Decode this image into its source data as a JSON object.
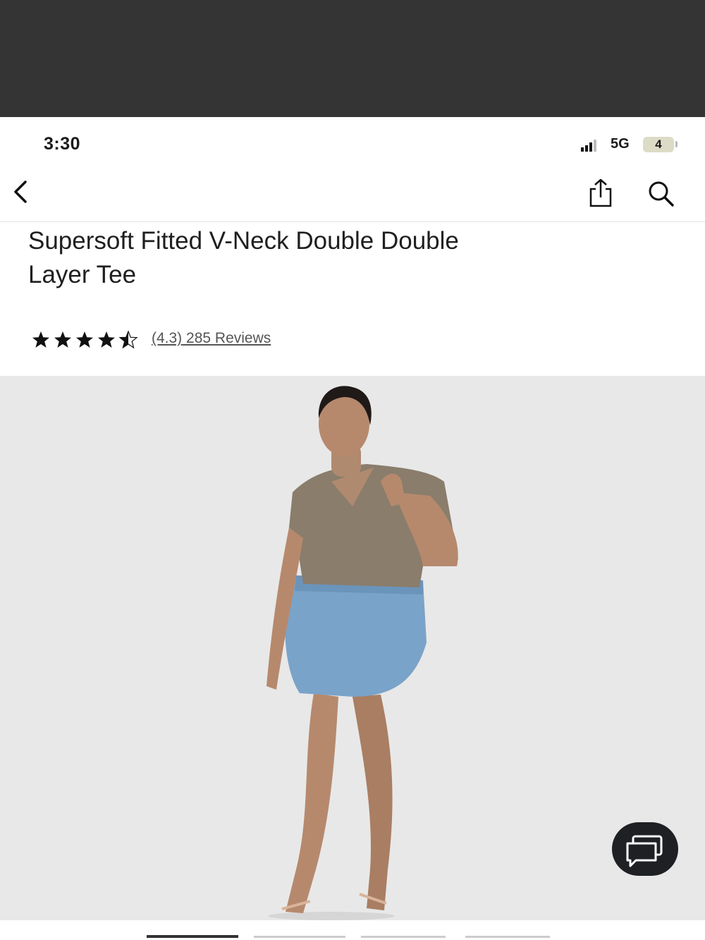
{
  "status_bar": {
    "time": "3:30",
    "network": "5G",
    "battery": "4"
  },
  "nav": {
    "back_icon": "chevron-left-icon",
    "share_icon": "share-icon",
    "search_icon": "search-icon"
  },
  "product": {
    "title_line1": "Supersoft Fitted V-Neck Double Double",
    "title_line2": "Layer Tee",
    "rating": 4.3,
    "rating_text": "(4.3)",
    "reviews_text": "285 Reviews"
  },
  "chat": {
    "icon": "chat-bubbles-icon"
  },
  "colors": {
    "top_bar": "#343434",
    "photo_bg": "#e8e8e8",
    "chat_button": "#1e2023",
    "tee": "#8a7d6c",
    "denim": "#7aa3c9"
  }
}
